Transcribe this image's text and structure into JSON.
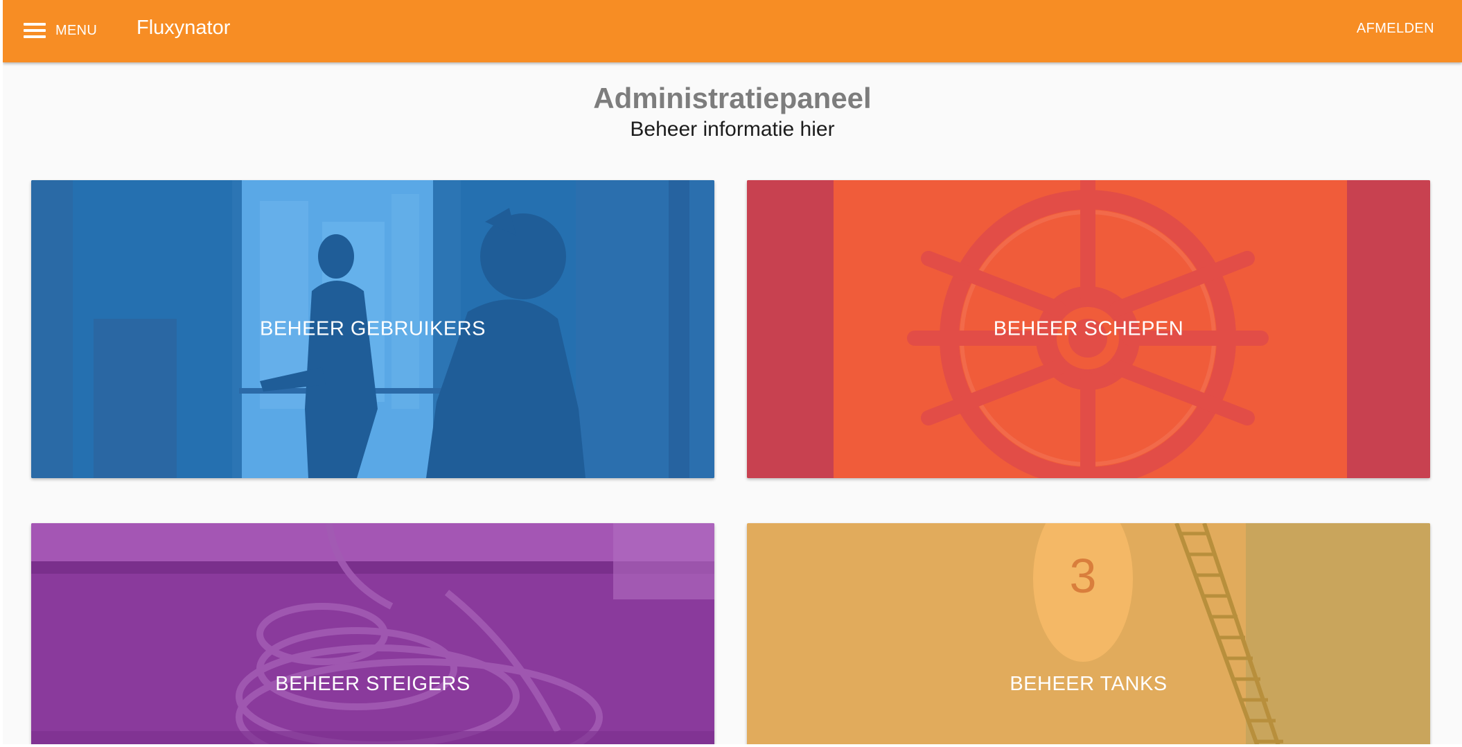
{
  "header": {
    "menu_label": "MENU",
    "brand": "Fluxynator",
    "logout_label": "AFMELDEN",
    "color": "#f78d24"
  },
  "main": {
    "title": "Administratiepaneel",
    "subtitle": "Beheer informatie hier"
  },
  "tiles": [
    {
      "label": "BEHEER GEBRUIKERS",
      "color": "#2570b0"
    },
    {
      "label": "BEHEER SCHEPEN",
      "color": "#f05c3a"
    },
    {
      "label": "BEHEER STEIGERS",
      "color": "#8a3a9c"
    },
    {
      "label": "BEHEER TANKS",
      "color": "#e1ab5c"
    }
  ]
}
